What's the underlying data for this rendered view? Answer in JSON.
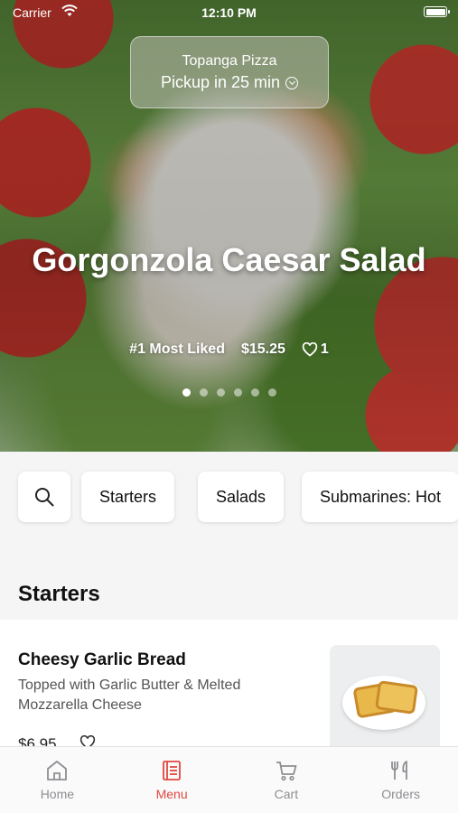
{
  "status_bar": {
    "carrier": "Carrier",
    "time": "12:10 PM"
  },
  "pickup": {
    "store": "Topanga Pizza",
    "time_label": "Pickup in 25 min"
  },
  "hero": {
    "title": "Gorgonzola Caesar Salad",
    "rank": "#1 Most Liked",
    "price": "$15.25",
    "likes": "1",
    "carousel_total": 6,
    "carousel_index": 0
  },
  "categories": [
    "Starters",
    "Salads",
    "Submarines: Hot"
  ],
  "section": {
    "title": "Starters"
  },
  "items": [
    {
      "name": "Cheesy Garlic Bread",
      "description": "Topped with Garlic Butter & Melted Mozzarella Cheese",
      "price": "$6.95"
    }
  ],
  "tabs": [
    {
      "label": "Home",
      "icon": "home-icon"
    },
    {
      "label": "Menu",
      "icon": "menu-icon"
    },
    {
      "label": "Cart",
      "icon": "cart-icon"
    },
    {
      "label": "Orders",
      "icon": "orders-icon"
    }
  ],
  "active_tab": "Menu",
  "colors": {
    "accent": "#e2463f",
    "inactive": "#8e8e93"
  }
}
